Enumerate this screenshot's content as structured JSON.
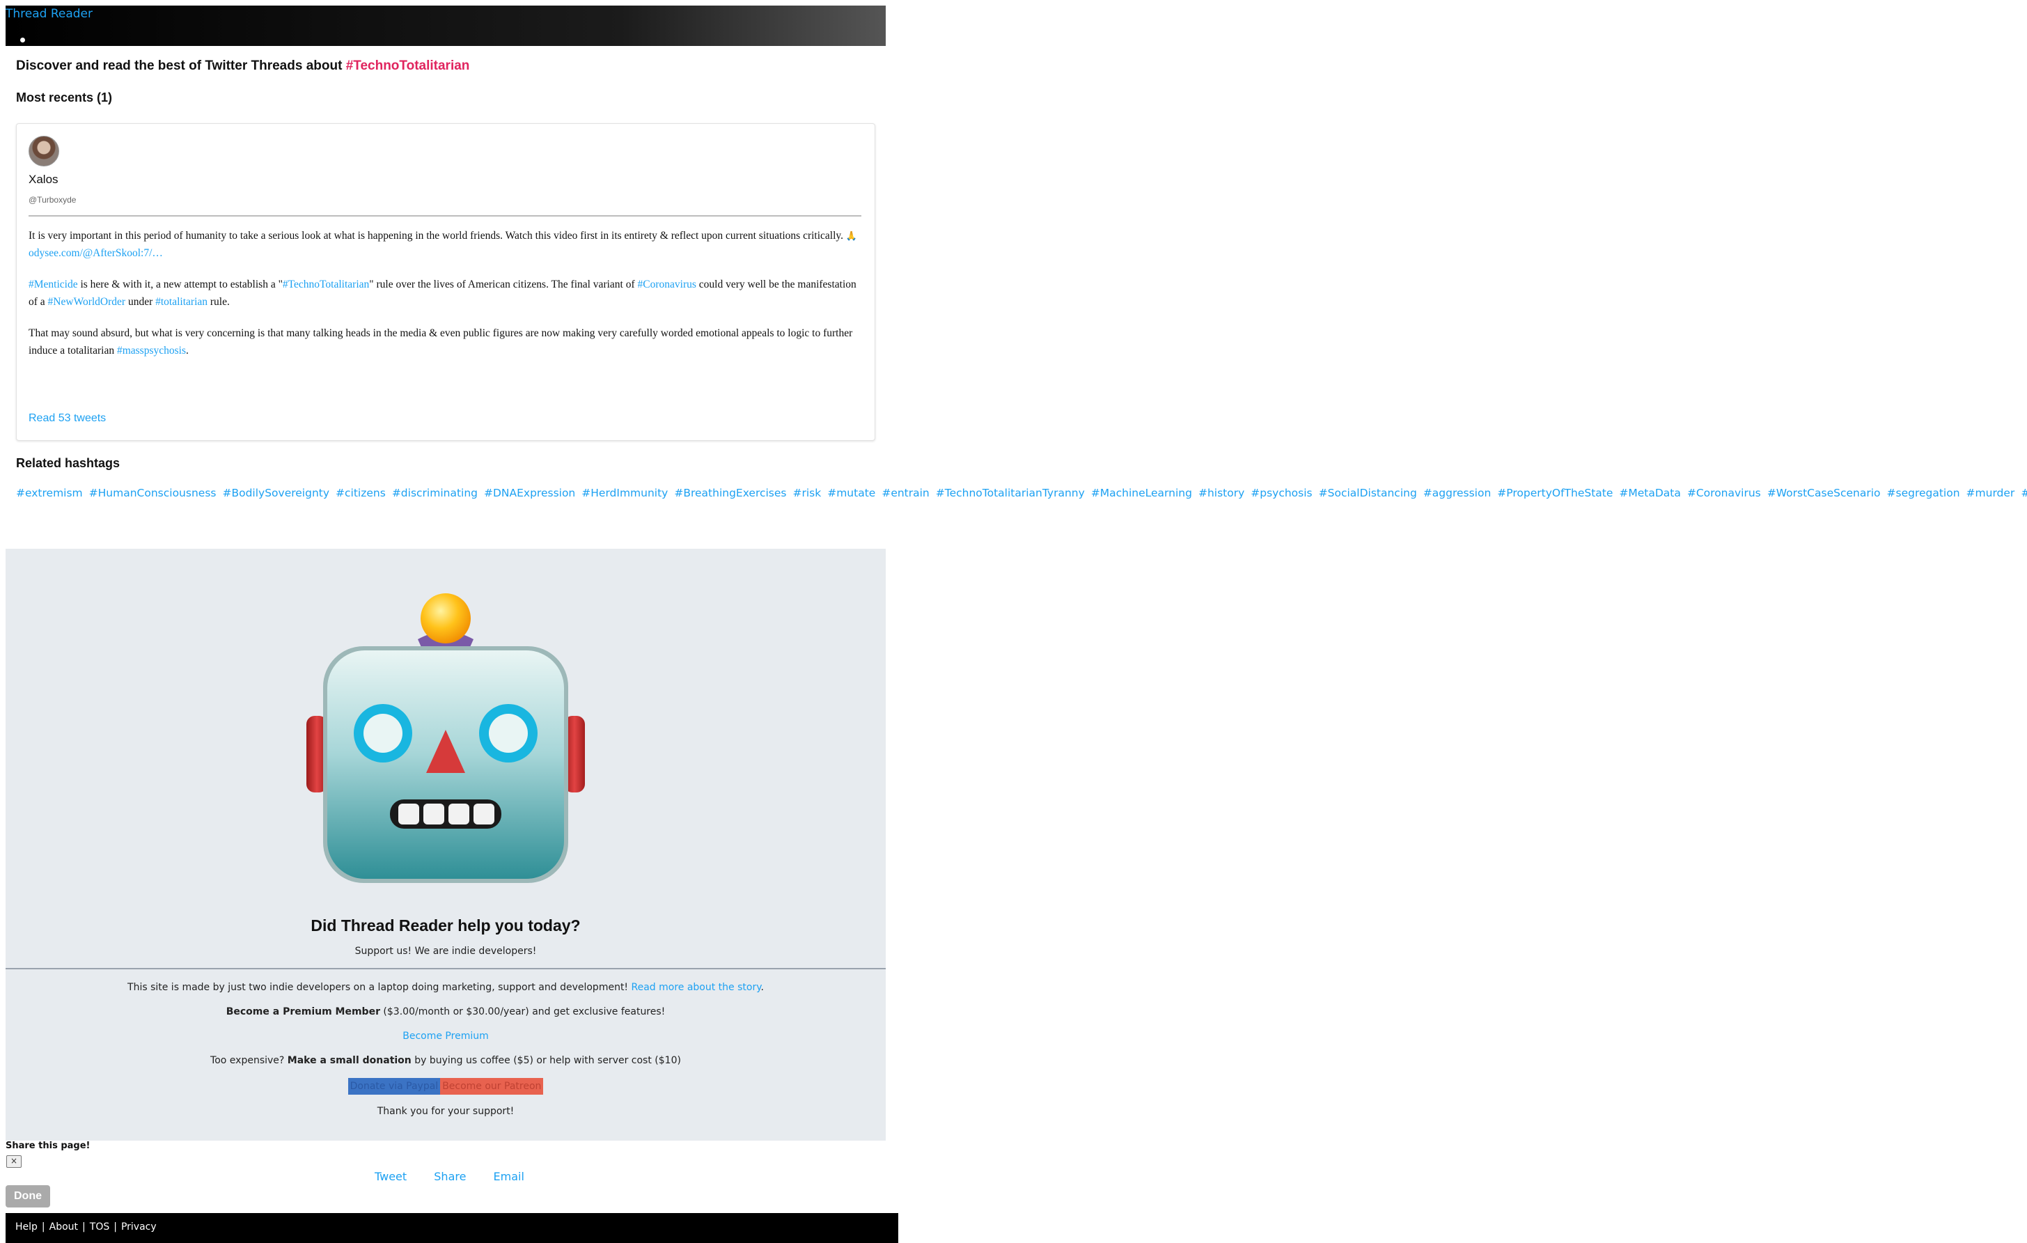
{
  "nav": {
    "brand": "Thread Reader"
  },
  "discover": {
    "prefix": "Discover and read the best of Twitter Threads about ",
    "hashtag": "#TechnoTotalitarian"
  },
  "recents": {
    "heading": "Most recents (1)"
  },
  "thread": {
    "author_name": "Xalos",
    "author_handle": "@Turboxyde",
    "p1_text": "It is very important in this period of humanity to take a serious look at what is happening in the world friends. Watch this video first in its entirety & reflect upon current situations critically. ",
    "p1_emoji": "🙏",
    "p1_link": "odysee.com/@AfterSkool:7/…",
    "p2_tag1": "#Menticide",
    "p2_t1": " is here & with it, a new attempt to establish a \"",
    "p2_tag2": "#TechnoTotalitarian",
    "p2_t2": "\" rule over the lives of American citizens. The final variant of ",
    "p2_tag3": "#Coronavirus",
    "p2_t3": " could very well be the manifestation of a ",
    "p2_tag4": "#NewWorldOrder",
    "p2_t4": " under ",
    "p2_tag5": "#totalitarian",
    "p2_t5": " rule.",
    "p3_text": "That may sound absurd, but what is very concerning is that many talking heads in the media & even public figures are now making very carefully worded emotional appeals to logic to further induce a totalitarian ",
    "p3_tag": "#masspsychosis",
    "p3_end": ".",
    "read_link": "Read 53 tweets"
  },
  "related": {
    "heading": "Related hashtags",
    "tags": [
      "#extremism",
      "#HumanConsciousness",
      "#BodilySovereignty",
      "#citizens",
      "#discriminating",
      "#DNAExpression",
      "#HerdImmunity",
      "#BreathingExercises",
      "#risk",
      "#mutate",
      "#entrain",
      "#TechnoTotalitarianTyranny",
      "#MachineLearning",
      "#history",
      "#psychosis",
      "#SocialDistancing",
      "#aggression",
      "#PropertyOfTheState",
      "#MetaData",
      "#Coronavirus",
      "#WorstCaseScenario",
      "#segregation",
      "#murder",
      "#virus"
    ]
  },
  "support": {
    "title": "Did Thread Reader help you today?",
    "subtitle": "Support us! We are indie developers!",
    "story_text": "This site is made by just two indie developers on a laptop doing marketing, support and development! ",
    "story_link": "Read more about the story",
    "story_end": ".",
    "premium_bold": "Become a Premium Member",
    "premium_rest": " ($3.00/month or $30.00/year) and get exclusive features!",
    "premium_link": "Become Premium",
    "donation_pre": "Too expensive? ",
    "donation_bold": "Make a small donation",
    "donation_rest": " by buying us coffee ($5) or help with server cost ($10)",
    "paypal": "Donate via Paypal",
    "patreon": "Become our Patreon",
    "thanks": "Thank you for your support!"
  },
  "share": {
    "label": "Share this page!",
    "close": "×",
    "links": [
      "Tweet",
      "Share",
      "Email"
    ],
    "done": "Done"
  },
  "footer": {
    "links": [
      "Help",
      "About",
      "TOS",
      "Privacy"
    ]
  },
  "colors": {
    "link": "#1da1f2",
    "hashtag_accent": "#e0245e",
    "support_bg": "#e7ebef",
    "paypal": "#3b73c4",
    "patreon": "#e8624f"
  }
}
